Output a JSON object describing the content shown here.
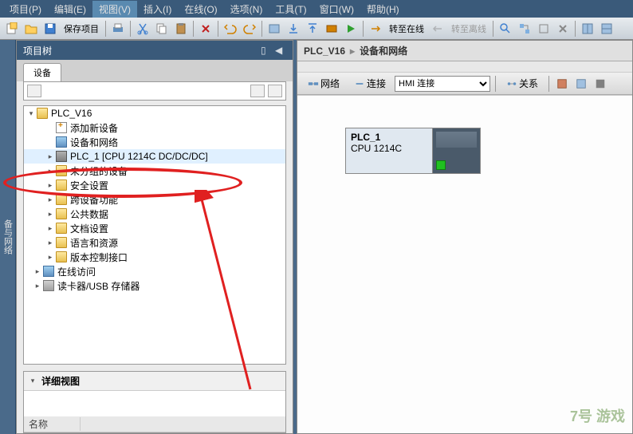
{
  "menu": {
    "items": [
      "项目(P)",
      "编辑(E)",
      "视图(V)",
      "插入(I)",
      "在线(O)",
      "选项(N)",
      "工具(T)",
      "窗口(W)",
      "帮助(H)"
    ],
    "active": 2
  },
  "toolbar": {
    "save": "保存项目",
    "goOnline": "转至在线",
    "goOffline": "转至离线"
  },
  "sideTab": "备与网络",
  "projectTree": {
    "title": "项目树",
    "tab": "设备",
    "rootName": "PLC_V16",
    "items": [
      {
        "label": "添加新设备",
        "icon": "add",
        "indent": 28
      },
      {
        "label": "设备和网络",
        "icon": "net",
        "indent": 28
      },
      {
        "label": "PLC_1 [CPU 1214C DC/DC/DC]",
        "icon": "plc",
        "indent": 28,
        "exp": true,
        "hl": true
      },
      {
        "label": "未分组的设备",
        "icon": "folder",
        "indent": 28,
        "exp": true
      },
      {
        "label": "安全设置",
        "icon": "folder",
        "indent": 28,
        "exp": true
      },
      {
        "label": "跨设备功能",
        "icon": "folder",
        "indent": 28,
        "exp": true
      },
      {
        "label": "公共数据",
        "icon": "folder",
        "indent": 28,
        "exp": true
      },
      {
        "label": "文档设置",
        "icon": "folder",
        "indent": 28,
        "exp": true
      },
      {
        "label": "语言和资源",
        "icon": "folder",
        "indent": 28,
        "exp": true
      },
      {
        "label": "版本控制接口",
        "icon": "folder",
        "indent": 28,
        "exp": true
      }
    ],
    "bottomItems": [
      {
        "label": "在线访问",
        "icon": "net",
        "indent": 12,
        "exp": true
      },
      {
        "label": "读卡器/USB 存储器",
        "icon": "card",
        "indent": 12,
        "exp": true
      }
    ]
  },
  "detail": {
    "title": "详细视图",
    "colName": "名称"
  },
  "breadcrumb": {
    "root": "PLC_V16",
    "leaf": "设备和网络"
  },
  "rightToolbar": {
    "network": "网络",
    "connect": "连接",
    "selectPlaceholder": "HMI 连接",
    "relation": "关系"
  },
  "device": {
    "name": "PLC_1",
    "cpu": "CPU 1214C"
  },
  "watermark": "7号 游戏"
}
